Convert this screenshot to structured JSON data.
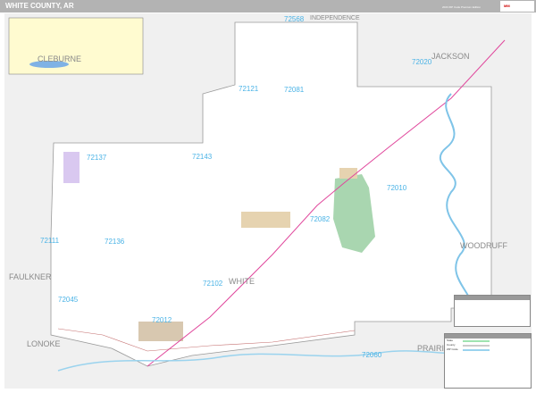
{
  "header": {
    "title": "WHITE COUNTY, AR",
    "edition": "2023 ZIP Code Premium Edition",
    "logo_text": "Marketmaps"
  },
  "counties": {
    "cleburne": "CLEBURNE",
    "jackson": "JACKSON",
    "independence": "INDEPENDENCE",
    "faulkner": "FAULKNER",
    "woodruff": "WOODRUFF",
    "white": "WHITE",
    "lonoke": "LONOKE",
    "prairie": "PRAIRIE"
  },
  "zips": {
    "z72568": "72568",
    "z72020": "72020",
    "z72121": "72121",
    "z72081": "72081",
    "z72137": "72137",
    "z72143": "72143",
    "z72010": "72010",
    "z72082": "72082",
    "z72111": "72111",
    "z72136": "72136",
    "z72102": "72102",
    "z72045": "72045",
    "z72012": "72012",
    "z72060": "72060"
  },
  "legend": {
    "rows": [
      "State",
      "County",
      "ZIP Code"
    ]
  },
  "colors": {
    "zip": "#4ab3e6",
    "county_label": "#8a8a8a",
    "header": "#b3b3b3",
    "interstate": "#e0479c",
    "water": "#bfe8f5",
    "park": "#a9d6b0",
    "urban": "#e6d3b0",
    "outside": "#f0f0f0",
    "inset": "#fffbd0"
  }
}
